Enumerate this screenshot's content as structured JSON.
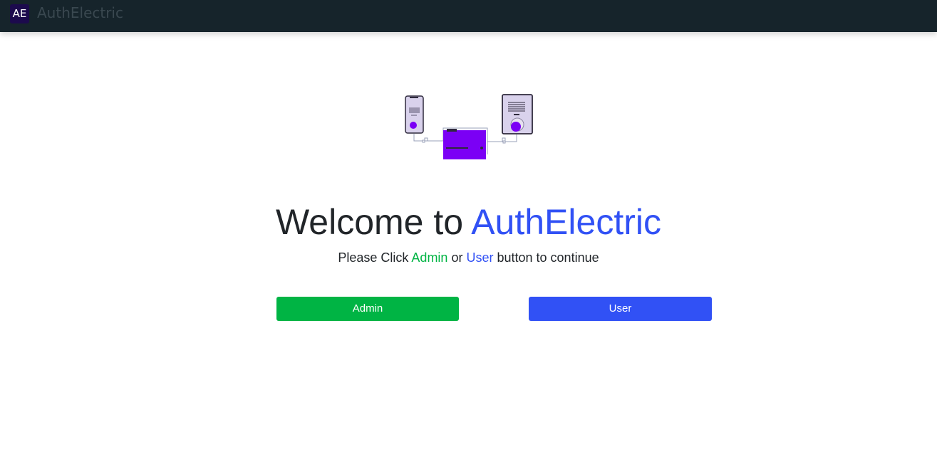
{
  "navbar": {
    "logo_text": "AE",
    "brand": "AuthElectric"
  },
  "main": {
    "welcome_prefix": "Welcome to ",
    "welcome_brand": "AuthElectric",
    "subtitle_prefix": "Please Click ",
    "subtitle_admin": "Admin",
    "subtitle_or": " or ",
    "subtitle_user": "User",
    "subtitle_suffix": " button to continue",
    "illustration_icon": "devices-connected-illustration"
  },
  "buttons": {
    "admin_label": "Admin",
    "user_label": "User"
  },
  "colors": {
    "navbar_bg": "#16242b",
    "accent_blue": "#3151f5",
    "accent_green": "#00b444",
    "illustration_purple": "#7b00f5"
  }
}
